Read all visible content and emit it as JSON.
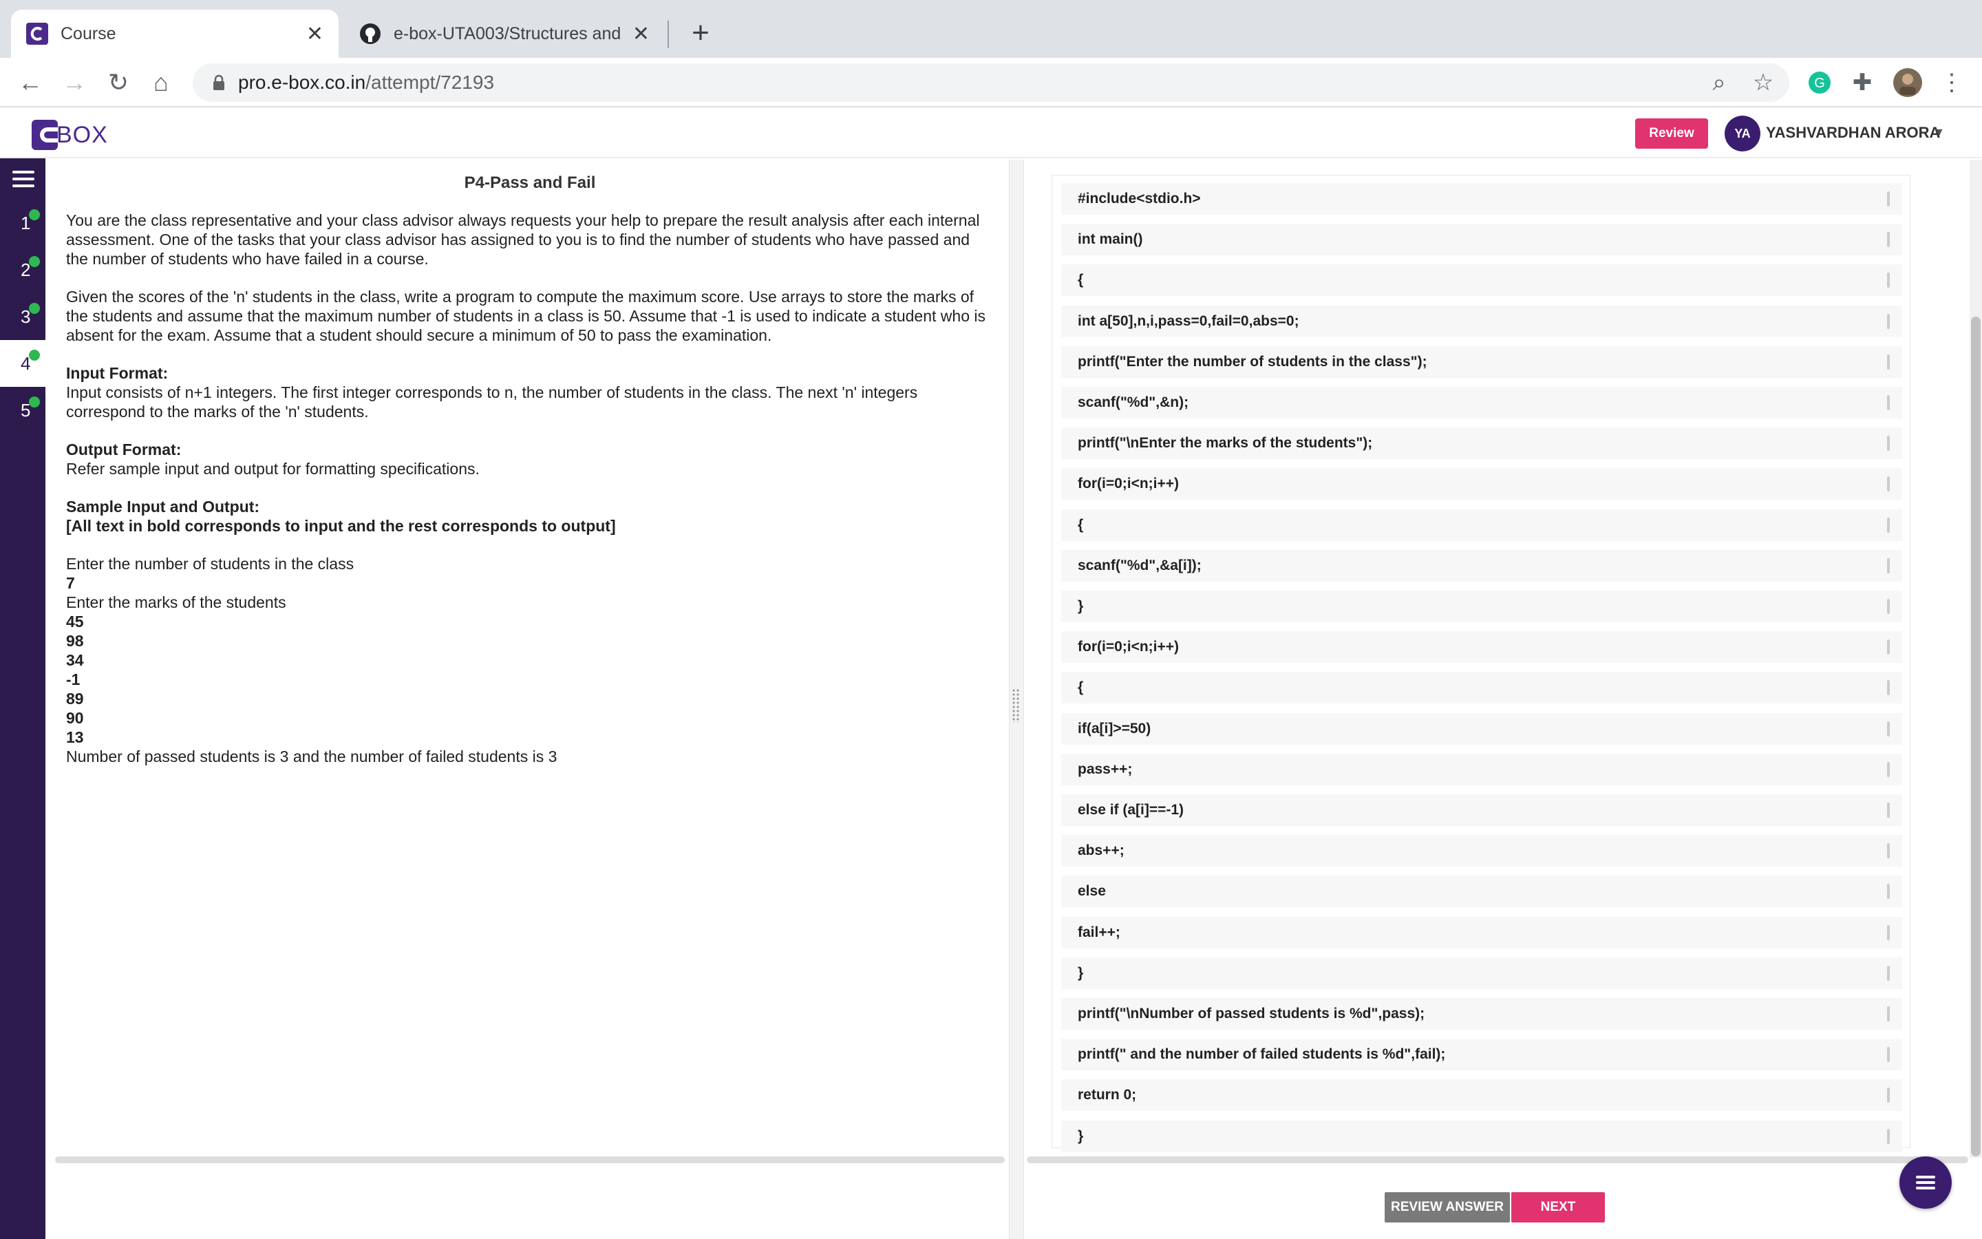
{
  "browser": {
    "tabs": [
      {
        "label": "Course",
        "icon": "ebox-favicon"
      },
      {
        "label": "e-box-UTA003/Structures and",
        "icon": "github-icon"
      }
    ],
    "url_host": "pro.e-box.co.in",
    "url_path": "/attempt/72193"
  },
  "header": {
    "logo_text": "BOX",
    "review_label": "Review",
    "avatar_initials": "YA",
    "user_name": "YASHVARDHAN ARORA"
  },
  "sidebar": {
    "questions": [
      "1",
      "2",
      "3",
      "4",
      "5"
    ],
    "active_index": 3
  },
  "problem": {
    "title": "P4-Pass and Fail",
    "para1": "You are the class representative and your class advisor always requests your help to prepare the result analysis after each internal assessment. One of the tasks that your class advisor has assigned to you is to find the number of students who have passed and the number of students who have failed in a course.",
    "para2": "Given the scores of the 'n' students in the class, write a program to compute the maximum score. Use arrays to store the marks of the students and assume that the maximum number of students in a class is 50. Assume that -1 is used to indicate a student who is absent for the exam. Assume that a student should secure a minimum of 50 to pass the examination.",
    "input_heading": "Input Format:",
    "input_text": "Input consists of n+1 integers. The first integer corresponds to n, the number of students in the class. The next 'n' integers correspond to the marks of the 'n' students.",
    "output_heading": "Output Format:",
    "output_text": "Refer sample input and output for formatting specifications.",
    "sample_heading": "Sample Input and Output:",
    "sample_note": "[All text in bold corresponds to input and the rest corresponds to output]",
    "sample": [
      {
        "text": "Enter the number of students in the class",
        "bold": false
      },
      {
        "text": "7",
        "bold": true
      },
      {
        "text": "Enter the marks of the students",
        "bold": false
      },
      {
        "text": "45",
        "bold": true
      },
      {
        "text": "98",
        "bold": true
      },
      {
        "text": "34",
        "bold": true
      },
      {
        "text": "-1",
        "bold": true
      },
      {
        "text": "89",
        "bold": true
      },
      {
        "text": "90",
        "bold": true
      },
      {
        "text": "13",
        "bold": true
      },
      {
        "text": "Number of passed students is 3 and the number of failed students is 3",
        "bold": false
      }
    ]
  },
  "code_lines": [
    "#include<stdio.h>",
    "int main()",
    "{",
    "int a[50],n,i,pass=0,fail=0,abs=0;",
    "printf(\"Enter the number of students in the class\");",
    "scanf(\"%d\",&n);",
    "printf(\"\\nEnter the marks of the students\");",
    "for(i=0;i<n;i++)",
    "{",
    "scanf(\"%d\",&a[i]);",
    "}",
    "for(i=0;i<n;i++)",
    "{",
    "if(a[i]>=50)",
    "pass++;",
    "else if (a[i]==-1)",
    "abs++;",
    "else",
    "fail++;",
    "}",
    "printf(\"\\nNumber of passed students is %d\",pass);",
    "printf(\" and the number of failed students is %d\",fail);",
    "return 0;",
    "}"
  ],
  "footer": {
    "review_answer_label": "REVIEW ANSWER",
    "next_label": "NEXT"
  },
  "colors": {
    "brand_purple": "#3a1d6e",
    "accent_pink": "#e0336f",
    "check_green": "#2fb84f"
  }
}
